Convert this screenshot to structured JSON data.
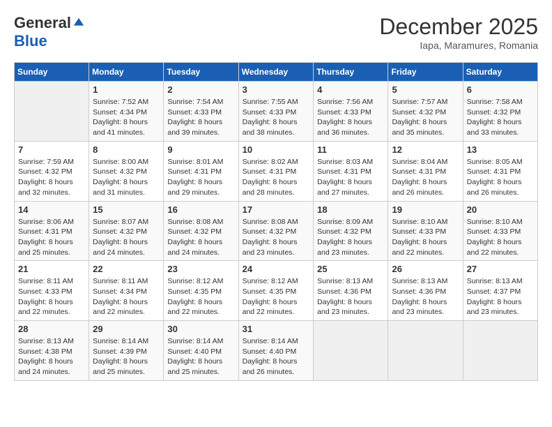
{
  "logo": {
    "general": "General",
    "blue": "Blue"
  },
  "title": "December 2025",
  "subtitle": "Iapa, Maramures, Romania",
  "days_of_week": [
    "Sunday",
    "Monday",
    "Tuesday",
    "Wednesday",
    "Thursday",
    "Friday",
    "Saturday"
  ],
  "weeks": [
    [
      {
        "day": "",
        "sunrise": "",
        "sunset": "",
        "daylight": ""
      },
      {
        "day": "1",
        "sunrise": "Sunrise: 7:52 AM",
        "sunset": "Sunset: 4:34 PM",
        "daylight": "Daylight: 8 hours and 41 minutes."
      },
      {
        "day": "2",
        "sunrise": "Sunrise: 7:54 AM",
        "sunset": "Sunset: 4:33 PM",
        "daylight": "Daylight: 8 hours and 39 minutes."
      },
      {
        "day": "3",
        "sunrise": "Sunrise: 7:55 AM",
        "sunset": "Sunset: 4:33 PM",
        "daylight": "Daylight: 8 hours and 38 minutes."
      },
      {
        "day": "4",
        "sunrise": "Sunrise: 7:56 AM",
        "sunset": "Sunset: 4:33 PM",
        "daylight": "Daylight: 8 hours and 36 minutes."
      },
      {
        "day": "5",
        "sunrise": "Sunrise: 7:57 AM",
        "sunset": "Sunset: 4:32 PM",
        "daylight": "Daylight: 8 hours and 35 minutes."
      },
      {
        "day": "6",
        "sunrise": "Sunrise: 7:58 AM",
        "sunset": "Sunset: 4:32 PM",
        "daylight": "Daylight: 8 hours and 33 minutes."
      }
    ],
    [
      {
        "day": "7",
        "sunrise": "Sunrise: 7:59 AM",
        "sunset": "Sunset: 4:32 PM",
        "daylight": "Daylight: 8 hours and 32 minutes."
      },
      {
        "day": "8",
        "sunrise": "Sunrise: 8:00 AM",
        "sunset": "Sunset: 4:32 PM",
        "daylight": "Daylight: 8 hours and 31 minutes."
      },
      {
        "day": "9",
        "sunrise": "Sunrise: 8:01 AM",
        "sunset": "Sunset: 4:31 PM",
        "daylight": "Daylight: 8 hours and 29 minutes."
      },
      {
        "day": "10",
        "sunrise": "Sunrise: 8:02 AM",
        "sunset": "Sunset: 4:31 PM",
        "daylight": "Daylight: 8 hours and 28 minutes."
      },
      {
        "day": "11",
        "sunrise": "Sunrise: 8:03 AM",
        "sunset": "Sunset: 4:31 PM",
        "daylight": "Daylight: 8 hours and 27 minutes."
      },
      {
        "day": "12",
        "sunrise": "Sunrise: 8:04 AM",
        "sunset": "Sunset: 4:31 PM",
        "daylight": "Daylight: 8 hours and 26 minutes."
      },
      {
        "day": "13",
        "sunrise": "Sunrise: 8:05 AM",
        "sunset": "Sunset: 4:31 PM",
        "daylight": "Daylight: 8 hours and 26 minutes."
      }
    ],
    [
      {
        "day": "14",
        "sunrise": "Sunrise: 8:06 AM",
        "sunset": "Sunset: 4:31 PM",
        "daylight": "Daylight: 8 hours and 25 minutes."
      },
      {
        "day": "15",
        "sunrise": "Sunrise: 8:07 AM",
        "sunset": "Sunset: 4:32 PM",
        "daylight": "Daylight: 8 hours and 24 minutes."
      },
      {
        "day": "16",
        "sunrise": "Sunrise: 8:08 AM",
        "sunset": "Sunset: 4:32 PM",
        "daylight": "Daylight: 8 hours and 24 minutes."
      },
      {
        "day": "17",
        "sunrise": "Sunrise: 8:08 AM",
        "sunset": "Sunset: 4:32 PM",
        "daylight": "Daylight: 8 hours and 23 minutes."
      },
      {
        "day": "18",
        "sunrise": "Sunrise: 8:09 AM",
        "sunset": "Sunset: 4:32 PM",
        "daylight": "Daylight: 8 hours and 23 minutes."
      },
      {
        "day": "19",
        "sunrise": "Sunrise: 8:10 AM",
        "sunset": "Sunset: 4:33 PM",
        "daylight": "Daylight: 8 hours and 22 minutes."
      },
      {
        "day": "20",
        "sunrise": "Sunrise: 8:10 AM",
        "sunset": "Sunset: 4:33 PM",
        "daylight": "Daylight: 8 hours and 22 minutes."
      }
    ],
    [
      {
        "day": "21",
        "sunrise": "Sunrise: 8:11 AM",
        "sunset": "Sunset: 4:33 PM",
        "daylight": "Daylight: 8 hours and 22 minutes."
      },
      {
        "day": "22",
        "sunrise": "Sunrise: 8:11 AM",
        "sunset": "Sunset: 4:34 PM",
        "daylight": "Daylight: 8 hours and 22 minutes."
      },
      {
        "day": "23",
        "sunrise": "Sunrise: 8:12 AM",
        "sunset": "Sunset: 4:35 PM",
        "daylight": "Daylight: 8 hours and 22 minutes."
      },
      {
        "day": "24",
        "sunrise": "Sunrise: 8:12 AM",
        "sunset": "Sunset: 4:35 PM",
        "daylight": "Daylight: 8 hours and 22 minutes."
      },
      {
        "day": "25",
        "sunrise": "Sunrise: 8:13 AM",
        "sunset": "Sunset: 4:36 PM",
        "daylight": "Daylight: 8 hours and 23 minutes."
      },
      {
        "day": "26",
        "sunrise": "Sunrise: 8:13 AM",
        "sunset": "Sunset: 4:36 PM",
        "daylight": "Daylight: 8 hours and 23 minutes."
      },
      {
        "day": "27",
        "sunrise": "Sunrise: 8:13 AM",
        "sunset": "Sunset: 4:37 PM",
        "daylight": "Daylight: 8 hours and 23 minutes."
      }
    ],
    [
      {
        "day": "28",
        "sunrise": "Sunrise: 8:13 AM",
        "sunset": "Sunset: 4:38 PM",
        "daylight": "Daylight: 8 hours and 24 minutes."
      },
      {
        "day": "29",
        "sunrise": "Sunrise: 8:14 AM",
        "sunset": "Sunset: 4:39 PM",
        "daylight": "Daylight: 8 hours and 25 minutes."
      },
      {
        "day": "30",
        "sunrise": "Sunrise: 8:14 AM",
        "sunset": "Sunset: 4:40 PM",
        "daylight": "Daylight: 8 hours and 25 minutes."
      },
      {
        "day": "31",
        "sunrise": "Sunrise: 8:14 AM",
        "sunset": "Sunset: 4:40 PM",
        "daylight": "Daylight: 8 hours and 26 minutes."
      },
      {
        "day": "",
        "sunrise": "",
        "sunset": "",
        "daylight": ""
      },
      {
        "day": "",
        "sunrise": "",
        "sunset": "",
        "daylight": ""
      },
      {
        "day": "",
        "sunrise": "",
        "sunset": "",
        "daylight": ""
      }
    ]
  ]
}
